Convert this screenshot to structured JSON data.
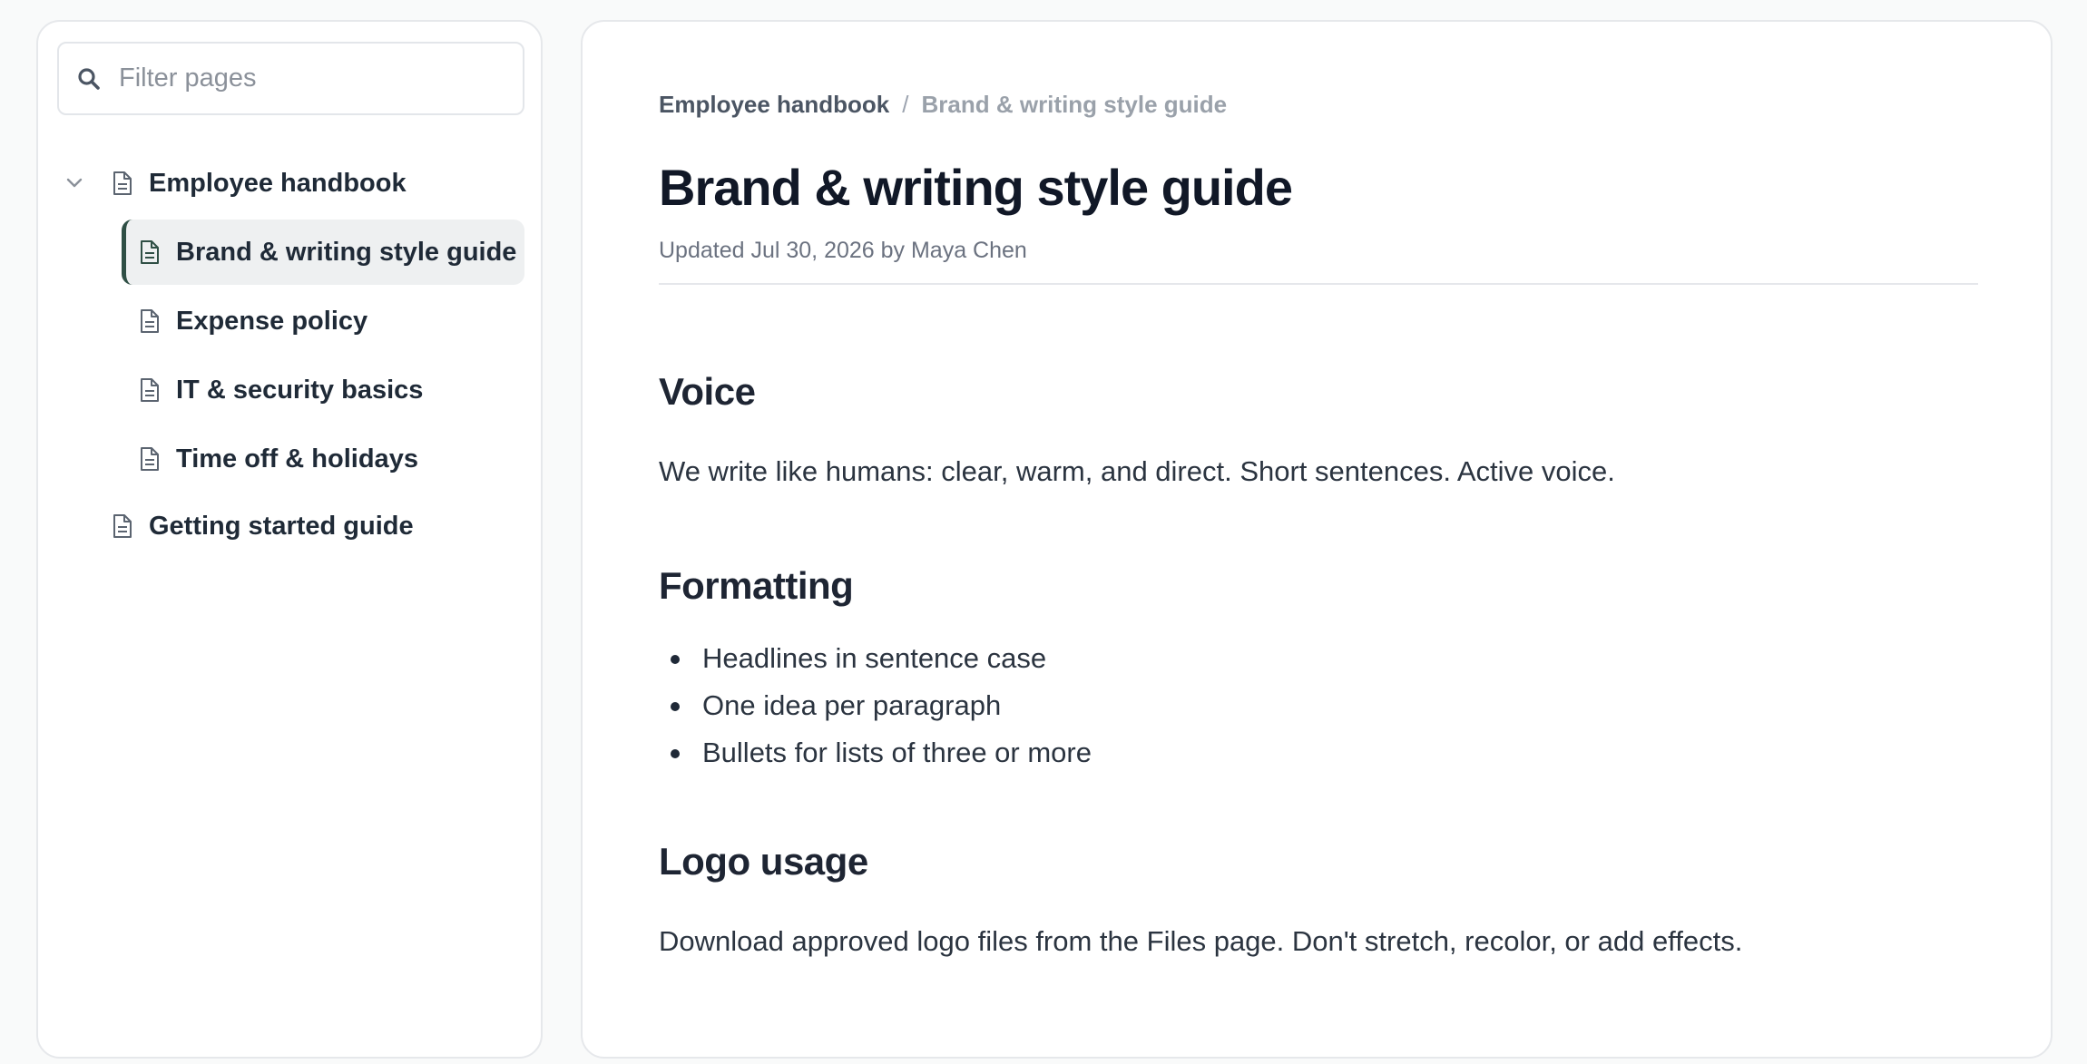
{
  "sidebar": {
    "filter_placeholder": "Filter pages",
    "items": [
      {
        "label": "Employee handbook",
        "expanded": true,
        "icon": "document-icon"
      },
      {
        "label": "Brand & writing style guide",
        "active": true,
        "icon": "document-icon"
      },
      {
        "label": "Expense policy",
        "icon": "document-icon"
      },
      {
        "label": "IT & security basics",
        "icon": "document-icon"
      },
      {
        "label": "Time off & holidays",
        "icon": "document-icon"
      },
      {
        "label": "Getting started guide",
        "icon": "document-icon"
      }
    ]
  },
  "page": {
    "breadcrumb": {
      "parent": "Employee handbook",
      "separator": "/",
      "current": "Brand & writing style guide"
    },
    "title": "Brand & writing style guide",
    "meta": "Updated Jul 30, 2026 by Maya Chen",
    "sections": [
      {
        "heading": "Voice",
        "body": "We write like humans: clear, warm, and direct. Short sentences. Active voice."
      },
      {
        "heading": "Formatting",
        "bullets": [
          "Headlines in sentence case",
          "One idea per paragraph",
          "Bullets for lists of three or more"
        ]
      },
      {
        "heading": "Logo usage",
        "body": "Download approved logo files from the Files page. Don't stretch, recolor, or add effects."
      }
    ]
  },
  "colors": {
    "accent": "#2f4f45",
    "active_bg": "#eef0f1",
    "background": "#f9fafa"
  }
}
